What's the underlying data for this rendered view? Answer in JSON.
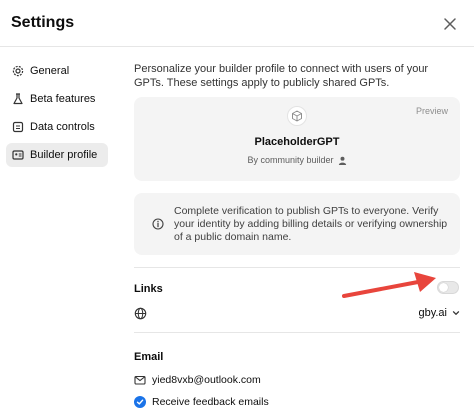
{
  "dialog": {
    "title": "Settings"
  },
  "nav": {
    "items": [
      {
        "label": "General",
        "icon": "gear-icon",
        "active": false
      },
      {
        "label": "Beta features",
        "icon": "flask-icon",
        "active": false
      },
      {
        "label": "Data controls",
        "icon": "database-icon",
        "active": false
      },
      {
        "label": "Builder profile",
        "icon": "id-card-icon",
        "active": true
      }
    ]
  },
  "builder": {
    "intro": "Personalize your builder profile to connect with users of your GPTs. These settings apply to publicly shared GPTs.",
    "preview": {
      "label": "Preview",
      "name": "PlaceholderGPT",
      "by": "By community builder"
    },
    "verification": {
      "text": "Complete verification to publish GPTs to everyone. Verify your identity by adding billing details or verifying ownership of a public domain name."
    },
    "links": {
      "label": "Links",
      "toggle_on": false,
      "domain": "gby.ai"
    },
    "email": {
      "label": "Email",
      "address": "yied8vxb@outlook.com",
      "feedback_label": "Receive feedback emails",
      "feedback_checked": true
    }
  },
  "colors": {
    "accent": "#1a73e8",
    "annotation_arrow": "#e8453c"
  }
}
